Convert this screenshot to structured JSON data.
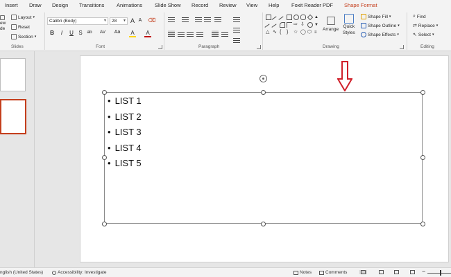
{
  "tabs": [
    "Insert",
    "Draw",
    "Design",
    "Transitions",
    "Animations",
    "Slide Show",
    "Record",
    "Review",
    "View",
    "Help",
    "Foxit Reader PDF",
    "Shape Format"
  ],
  "active_tab": "Shape Format",
  "ribbon": {
    "slides": {
      "label": "Slides",
      "new_slide": "ew",
      "new_slide2": "de",
      "layout": "Layout",
      "reset": "Reset",
      "section": "Section"
    },
    "font": {
      "label": "Font",
      "font_name": "Calibri (Body)",
      "font_size": "28",
      "bold": "B",
      "italic": "I",
      "underline": "U",
      "strike": "S",
      "shadow": "ab",
      "spacing": "AV",
      "case": "Aa",
      "grow": "A",
      "shrink": "A",
      "highlight": "A",
      "color": "A"
    },
    "paragraph": {
      "label": "Paragraph"
    },
    "drawing": {
      "label": "Drawing",
      "arrange": "Arrange",
      "quick_styles_1": "Quick",
      "quick_styles_2": "Styles",
      "shape_fill": "Shape Fill",
      "shape_outline": "Shape Outline",
      "shape_effects": "Shape Effects"
    },
    "editing": {
      "label": "Editing",
      "find": "Find",
      "replace": "Replace",
      "select": "Select"
    }
  },
  "slide": {
    "bullets": [
      "LIST 1",
      "LIST 2",
      "LIST 3",
      "LIST 4",
      "LIST 5"
    ]
  },
  "statusbar": {
    "language": "nglish (United States)",
    "accessibility": "Accessibility: Investigate",
    "notes": "Notes",
    "comments": "Comments"
  },
  "colors": {
    "accent": "#c43e1c",
    "annotation_arrow": "#d0202a",
    "highlight": "#ffd400",
    "font_color": "#c00000"
  }
}
